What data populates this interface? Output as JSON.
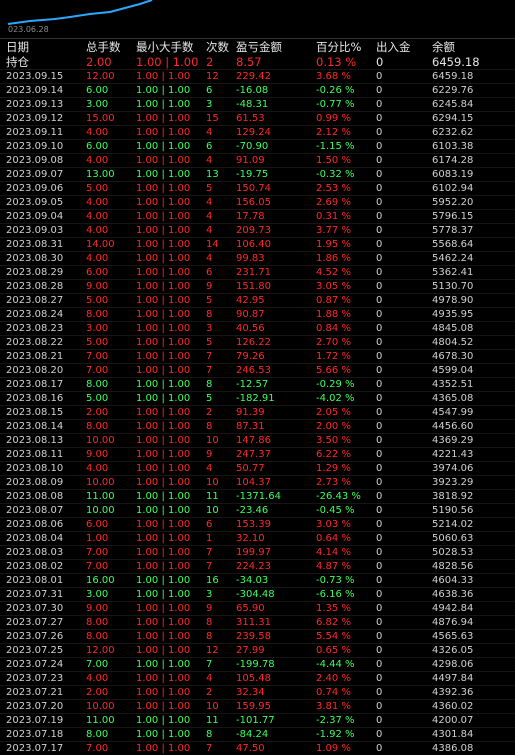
{
  "chart": {
    "date_label": "023.06.28",
    "line_color": "#2aa8ff"
  },
  "columns": {
    "date": "日期",
    "qty": "总手数",
    "minmax": "最小大手数",
    "count": "次数",
    "pl": "盈亏金额",
    "pct": "百分比%",
    "flow": "出入金",
    "balance": "余额"
  },
  "position_row": {
    "label": "持仓",
    "qty": "2.00",
    "minmax": "1.00 | 1.00",
    "count": "2",
    "pl": "8.57",
    "pct": "0.13 %",
    "flow": "0",
    "balance": "6459.18"
  },
  "colors": {
    "profit": "#ff2828",
    "loss": "#3cff5a",
    "neutral": "#d0d0d0"
  },
  "rows": [
    {
      "date": "2023.09.15",
      "qty": "12.00",
      "minmax": "1.00 | 1.00",
      "count": "12",
      "pl": "229.42",
      "pct": "3.68 %",
      "flow": "0",
      "balance": "6459.18"
    },
    {
      "date": "2023.09.14",
      "qty": "6.00",
      "minmax": "1.00 | 1.00",
      "count": "6",
      "pl": "-16.08",
      "pct": "-0.26 %",
      "flow": "0",
      "balance": "6229.76"
    },
    {
      "date": "2023.09.13",
      "qty": "3.00",
      "minmax": "1.00 | 1.00",
      "count": "3",
      "pl": "-48.31",
      "pct": "-0.77 %",
      "flow": "0",
      "balance": "6245.84"
    },
    {
      "date": "2023.09.12",
      "qty": "15.00",
      "minmax": "1.00 | 1.00",
      "count": "15",
      "pl": "61.53",
      "pct": "0.99 %",
      "flow": "0",
      "balance": "6294.15"
    },
    {
      "date": "2023.09.11",
      "qty": "4.00",
      "minmax": "1.00 | 1.00",
      "count": "4",
      "pl": "129.24",
      "pct": "2.12 %",
      "flow": "0",
      "balance": "6232.62"
    },
    {
      "date": "2023.09.10",
      "qty": "6.00",
      "minmax": "1.00 | 1.00",
      "count": "6",
      "pl": "-70.90",
      "pct": "-1.15 %",
      "flow": "0",
      "balance": "6103.38"
    },
    {
      "date": "2023.09.08",
      "qty": "4.00",
      "minmax": "1.00 | 1.00",
      "count": "4",
      "pl": "91.09",
      "pct": "1.50 %",
      "flow": "0",
      "balance": "6174.28"
    },
    {
      "date": "2023.09.07",
      "qty": "13.00",
      "minmax": "1.00 | 1.00",
      "count": "13",
      "pl": "-19.75",
      "pct": "-0.32 %",
      "flow": "0",
      "balance": "6083.19"
    },
    {
      "date": "2023.09.06",
      "qty": "5.00",
      "minmax": "1.00 | 1.00",
      "count": "5",
      "pl": "150.74",
      "pct": "2.53 %",
      "flow": "0",
      "balance": "6102.94"
    },
    {
      "date": "2023.09.05",
      "qty": "4.00",
      "minmax": "1.00 | 1.00",
      "count": "4",
      "pl": "156.05",
      "pct": "2.69 %",
      "flow": "0",
      "balance": "5952.20"
    },
    {
      "date": "2023.09.04",
      "qty": "4.00",
      "minmax": "1.00 | 1.00",
      "count": "4",
      "pl": "17.78",
      "pct": "0.31 %",
      "flow": "0",
      "balance": "5796.15"
    },
    {
      "date": "2023.09.03",
      "qty": "4.00",
      "minmax": "1.00 | 1.00",
      "count": "4",
      "pl": "209.73",
      "pct": "3.77 %",
      "flow": "0",
      "balance": "5778.37"
    },
    {
      "date": "2023.08.31",
      "qty": "14.00",
      "minmax": "1.00 | 1.00",
      "count": "14",
      "pl": "106.40",
      "pct": "1.95 %",
      "flow": "0",
      "balance": "5568.64"
    },
    {
      "date": "2023.08.30",
      "qty": "4.00",
      "minmax": "1.00 | 1.00",
      "count": "4",
      "pl": "99.83",
      "pct": "1.86 %",
      "flow": "0",
      "balance": "5462.24"
    },
    {
      "date": "2023.08.29",
      "qty": "6.00",
      "minmax": "1.00 | 1.00",
      "count": "6",
      "pl": "231.71",
      "pct": "4.52 %",
      "flow": "0",
      "balance": "5362.41"
    },
    {
      "date": "2023.08.28",
      "qty": "9.00",
      "minmax": "1.00 | 1.00",
      "count": "9",
      "pl": "151.80",
      "pct": "3.05 %",
      "flow": "0",
      "balance": "5130.70"
    },
    {
      "date": "2023.08.27",
      "qty": "5.00",
      "minmax": "1.00 | 1.00",
      "count": "5",
      "pl": "42.95",
      "pct": "0.87 %",
      "flow": "0",
      "balance": "4978.90"
    },
    {
      "date": "2023.08.24",
      "qty": "8.00",
      "minmax": "1.00 | 1.00",
      "count": "8",
      "pl": "90.87",
      "pct": "1.88 %",
      "flow": "0",
      "balance": "4935.95"
    },
    {
      "date": "2023.08.23",
      "qty": "3.00",
      "minmax": "1.00 | 1.00",
      "count": "3",
      "pl": "40.56",
      "pct": "0.84 %",
      "flow": "0",
      "balance": "4845.08"
    },
    {
      "date": "2023.08.22",
      "qty": "5.00",
      "minmax": "1.00 | 1.00",
      "count": "5",
      "pl": "126.22",
      "pct": "2.70 %",
      "flow": "0",
      "balance": "4804.52"
    },
    {
      "date": "2023.08.21",
      "qty": "7.00",
      "minmax": "1.00 | 1.00",
      "count": "7",
      "pl": "79.26",
      "pct": "1.72 %",
      "flow": "0",
      "balance": "4678.30"
    },
    {
      "date": "2023.08.20",
      "qty": "7.00",
      "minmax": "1.00 | 1.00",
      "count": "7",
      "pl": "246.53",
      "pct": "5.66 %",
      "flow": "0",
      "balance": "4599.04"
    },
    {
      "date": "2023.08.17",
      "qty": "8.00",
      "minmax": "1.00 | 1.00",
      "count": "8",
      "pl": "-12.57",
      "pct": "-0.29 %",
      "flow": "0",
      "balance": "4352.51"
    },
    {
      "date": "2023.08.16",
      "qty": "5.00",
      "minmax": "1.00 | 1.00",
      "count": "5",
      "pl": "-182.91",
      "pct": "-4.02 %",
      "flow": "0",
      "balance": "4365.08"
    },
    {
      "date": "2023.08.15",
      "qty": "2.00",
      "minmax": "1.00 | 1.00",
      "count": "2",
      "pl": "91.39",
      "pct": "2.05 %",
      "flow": "0",
      "balance": "4547.99"
    },
    {
      "date": "2023.08.14",
      "qty": "8.00",
      "minmax": "1.00 | 1.00",
      "count": "8",
      "pl": "87.31",
      "pct": "2.00 %",
      "flow": "0",
      "balance": "4456.60"
    },
    {
      "date": "2023.08.13",
      "qty": "10.00",
      "minmax": "1.00 | 1.00",
      "count": "10",
      "pl": "147.86",
      "pct": "3.50 %",
      "flow": "0",
      "balance": "4369.29"
    },
    {
      "date": "2023.08.11",
      "qty": "9.00",
      "minmax": "1.00 | 1.00",
      "count": "9",
      "pl": "247.37",
      "pct": "6.22 %",
      "flow": "0",
      "balance": "4221.43"
    },
    {
      "date": "2023.08.10",
      "qty": "4.00",
      "minmax": "1.00 | 1.00",
      "count": "4",
      "pl": "50.77",
      "pct": "1.29 %",
      "flow": "0",
      "balance": "3974.06"
    },
    {
      "date": "2023.08.09",
      "qty": "10.00",
      "minmax": "1.00 | 1.00",
      "count": "10",
      "pl": "104.37",
      "pct": "2.73 %",
      "flow": "0",
      "balance": "3923.29"
    },
    {
      "date": "2023.08.08",
      "qty": "11.00",
      "minmax": "1.00 | 1.00",
      "count": "11",
      "pl": "-1371.64",
      "pct": "-26.43 %",
      "flow": "0",
      "balance": "3818.92"
    },
    {
      "date": "2023.08.07",
      "qty": "10.00",
      "minmax": "1.00 | 1.00",
      "count": "10",
      "pl": "-23.46",
      "pct": "-0.45 %",
      "flow": "0",
      "balance": "5190.56"
    },
    {
      "date": "2023.08.06",
      "qty": "6.00",
      "minmax": "1.00 | 1.00",
      "count": "6",
      "pl": "153.39",
      "pct": "3.03 %",
      "flow": "0",
      "balance": "5214.02"
    },
    {
      "date": "2023.08.04",
      "qty": "1.00",
      "minmax": "1.00 | 1.00",
      "count": "1",
      "pl": "32.10",
      "pct": "0.64 %",
      "flow": "0",
      "balance": "5060.63"
    },
    {
      "date": "2023.08.03",
      "qty": "7.00",
      "minmax": "1.00 | 1.00",
      "count": "7",
      "pl": "199.97",
      "pct": "4.14 %",
      "flow": "0",
      "balance": "5028.53"
    },
    {
      "date": "2023.08.02",
      "qty": "7.00",
      "minmax": "1.00 | 1.00",
      "count": "7",
      "pl": "224.23",
      "pct": "4.87 %",
      "flow": "0",
      "balance": "4828.56"
    },
    {
      "date": "2023.08.01",
      "qty": "16.00",
      "minmax": "1.00 | 1.00",
      "count": "16",
      "pl": "-34.03",
      "pct": "-0.73 %",
      "flow": "0",
      "balance": "4604.33"
    },
    {
      "date": "2023.07.31",
      "qty": "3.00",
      "minmax": "1.00 | 1.00",
      "count": "3",
      "pl": "-304.48",
      "pct": "-6.16 %",
      "flow": "0",
      "balance": "4638.36"
    },
    {
      "date": "2023.07.30",
      "qty": "9.00",
      "minmax": "1.00 | 1.00",
      "count": "9",
      "pl": "65.90",
      "pct": "1.35 %",
      "flow": "0",
      "balance": "4942.84"
    },
    {
      "date": "2023.07.27",
      "qty": "8.00",
      "minmax": "1.00 | 1.00",
      "count": "8",
      "pl": "311.31",
      "pct": "6.82 %",
      "flow": "0",
      "balance": "4876.94"
    },
    {
      "date": "2023.07.26",
      "qty": "8.00",
      "minmax": "1.00 | 1.00",
      "count": "8",
      "pl": "239.58",
      "pct": "5.54 %",
      "flow": "0",
      "balance": "4565.63"
    },
    {
      "date": "2023.07.25",
      "qty": "12.00",
      "minmax": "1.00 | 1.00",
      "count": "12",
      "pl": "27.99",
      "pct": "0.65 %",
      "flow": "0",
      "balance": "4326.05"
    },
    {
      "date": "2023.07.24",
      "qty": "7.00",
      "minmax": "1.00 | 1.00",
      "count": "7",
      "pl": "-199.78",
      "pct": "-4.44 %",
      "flow": "0",
      "balance": "4298.06"
    },
    {
      "date": "2023.07.23",
      "qty": "4.00",
      "minmax": "1.00 | 1.00",
      "count": "4",
      "pl": "105.48",
      "pct": "2.40 %",
      "flow": "0",
      "balance": "4497.84"
    },
    {
      "date": "2023.07.21",
      "qty": "2.00",
      "minmax": "1.00 | 1.00",
      "count": "2",
      "pl": "32.34",
      "pct": "0.74 %",
      "flow": "0",
      "balance": "4392.36"
    },
    {
      "date": "2023.07.20",
      "qty": "10.00",
      "minmax": "1.00 | 1.00",
      "count": "10",
      "pl": "159.95",
      "pct": "3.81 %",
      "flow": "0",
      "balance": "4360.02"
    },
    {
      "date": "2023.07.19",
      "qty": "11.00",
      "minmax": "1.00 | 1.00",
      "count": "11",
      "pl": "-101.77",
      "pct": "-2.37 %",
      "flow": "0",
      "balance": "4200.07"
    },
    {
      "date": "2023.07.18",
      "qty": "8.00",
      "minmax": "1.00 | 1.00",
      "count": "8",
      "pl": "-84.24",
      "pct": "-1.92 %",
      "flow": "0",
      "balance": "4301.84"
    },
    {
      "date": "2023.07.17",
      "qty": "7.00",
      "minmax": "1.00 | 1.00",
      "count": "7",
      "pl": "47.50",
      "pct": "1.09 %",
      "flow": "0",
      "balance": "4386.08"
    }
  ]
}
